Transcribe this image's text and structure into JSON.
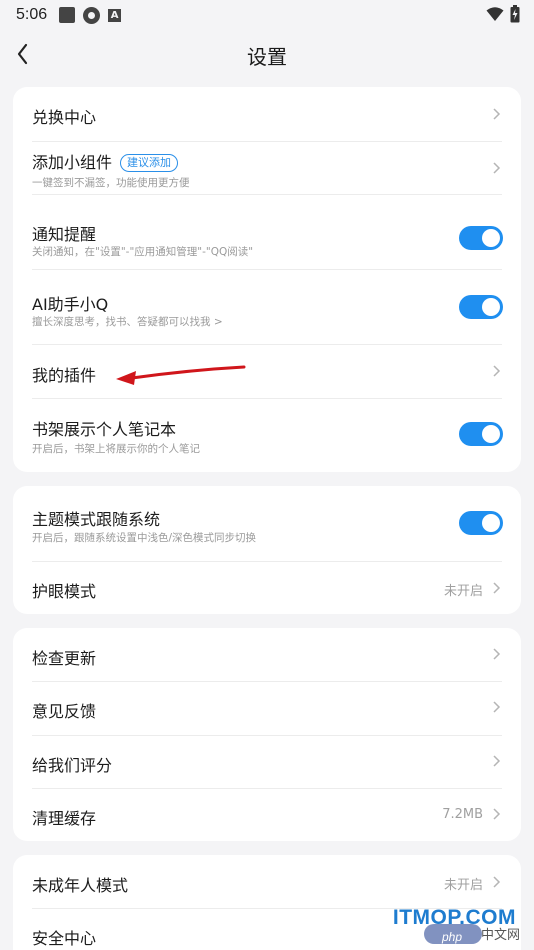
{
  "status_bar": {
    "time": "5:06",
    "left_icons": [
      "notification-square-icon",
      "sync-icon",
      "a-icon"
    ],
    "right_icons": [
      "wifi-icon",
      "battery-icon"
    ]
  },
  "header": {
    "title": "设置",
    "back_icon": "chevron-left-icon"
  },
  "sections": [
    {
      "rows": [
        {
          "title": "兑换中心",
          "type": "link"
        },
        {
          "title": "添加小组件",
          "badge": "建议添加",
          "subtitle": "一键签到不漏签，功能使用更方便",
          "type": "link"
        },
        {
          "title": "通知提醒",
          "subtitle": "关闭通知，在\"设置\"-\"应用通知管理\"-\"QQ阅读\"",
          "type": "toggle",
          "on": true
        },
        {
          "title": "AI助手小Q",
          "subtitle": "擅长深度思考，找书、答疑都可以找我 >",
          "type": "toggle",
          "on": true
        },
        {
          "title": "我的插件",
          "type": "link"
        },
        {
          "title": "书架展示个人笔记本",
          "subtitle": "开启后，书架上将展示你的个人笔记",
          "type": "toggle",
          "on": true
        }
      ]
    },
    {
      "rows": [
        {
          "title": "主题模式跟随系统",
          "subtitle": "开启后，跟随系统设置中浅色/深色模式同步切换",
          "type": "toggle",
          "on": true
        },
        {
          "title": "护眼模式",
          "value": "未开启",
          "type": "link"
        }
      ]
    },
    {
      "rows": [
        {
          "title": "检查更新",
          "type": "link"
        },
        {
          "title": "意见反馈",
          "type": "link"
        },
        {
          "title": "给我们评分",
          "type": "link"
        },
        {
          "title": "清理缓存",
          "value": "7.2MB",
          "type": "link"
        }
      ]
    },
    {
      "rows": [
        {
          "title": "未成年人模式",
          "value": "未开启",
          "type": "link"
        },
        {
          "title": "安全中心",
          "type": "link"
        }
      ]
    }
  ],
  "watermark": {
    "main": "ITMOP.COM",
    "php": "php",
    "cn": "中文网"
  },
  "colors": {
    "accent": "#1f8ff0",
    "background": "#f4f4f6",
    "annotation_arrow": "#d0161b"
  }
}
